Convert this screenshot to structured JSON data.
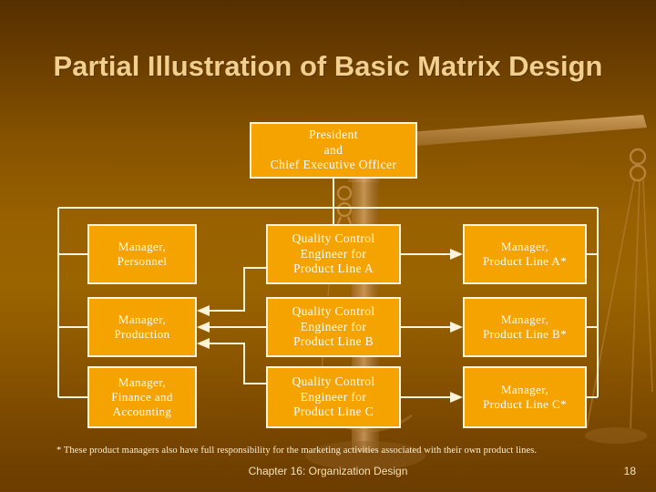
{
  "slide": {
    "title": "Partial Illustration of Basic Matrix Design",
    "background_top_color": "#562f00",
    "background_mid_color": "#9a6400",
    "background_bottom_color": "#6b3c00",
    "box_fill_color": "#f5a300",
    "box_border_color": "#fdf3d8",
    "box_text_color": "#ffffff",
    "title_color": "#f0cf8f",
    "connector_color": "#fdf3d8",
    "watermark_icon": "balance-scale-icon"
  },
  "chart": {
    "president": {
      "line1": "President",
      "line2": "and",
      "line3": "Chief Executive Officer"
    },
    "columns": {
      "functional": [
        {
          "line1": "Manager,",
          "line2": "Personnel",
          "line3": ""
        },
        {
          "line1": "Manager,",
          "line2": "Production",
          "line3": ""
        },
        {
          "line1": "Manager,",
          "line2": "Finance and",
          "line3": "Accounting"
        }
      ],
      "quality": [
        {
          "line1": "Quality Control",
          "line2": "Engineer for",
          "line3": "Product Line A"
        },
        {
          "line1": "Quality Control",
          "line2": "Engineer for",
          "line3": "Product Line B"
        },
        {
          "line1": "Quality Control",
          "line2": "Engineer for",
          "line3": "Product Line C"
        }
      ],
      "product": [
        {
          "line1": "Manager,",
          "line2": "Product Line A*",
          "line3": ""
        },
        {
          "line1": "Manager,",
          "line2": "Product Line B*",
          "line3": ""
        },
        {
          "line1": "Manager,",
          "line2": "Product Line C*",
          "line3": ""
        }
      ]
    }
  },
  "footnote": "* These product managers also have full responsibility for the marketing activities associated with their own product lines.",
  "footer": {
    "title": "Chapter 16: Organization Design",
    "page": "18"
  }
}
